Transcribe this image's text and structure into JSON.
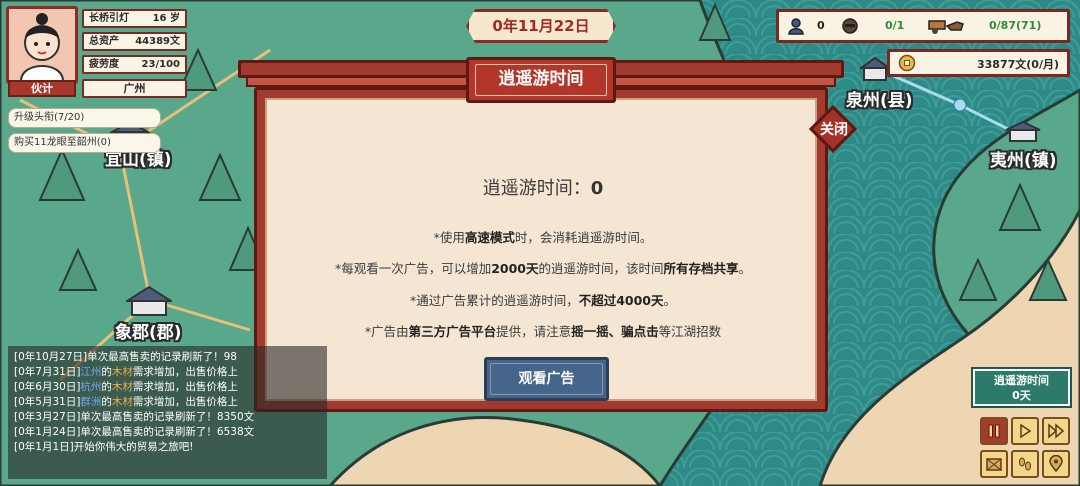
{
  "player": {
    "stats": [
      {
        "key": "长桥引灯",
        "value": "16 岁"
      },
      {
        "key": "总资产",
        "value": "44389文"
      },
      {
        "key": "疲劳度",
        "value": "23/100"
      }
    ],
    "role": "伙计",
    "city": "广州"
  },
  "tasks": [
    {
      "label": "升级头衔(7/20)"
    },
    {
      "label": "购买11龙眼至韶州(0)"
    }
  ],
  "date": "0年11月22日",
  "resources": {
    "person_count": "0",
    "bandit_count": "0/1",
    "cart_count": "0/87(71)",
    "money": "33877文(0/月)"
  },
  "map": {
    "towns": [
      {
        "name": "宜山(镇)"
      },
      {
        "name": "象郡(郡)"
      },
      {
        "name": "泉州(县)"
      },
      {
        "name": "夷州(镇)"
      }
    ],
    "colors": {
      "sea": "#2e8a86",
      "land": "#5aa88b",
      "sand": "#efd6b3",
      "road": "#e7c07a"
    }
  },
  "dialog": {
    "title": "逍遥游时间",
    "close": "关闭",
    "free_time_label": "逍遥游时间：",
    "free_time_value": "0",
    "rules": [
      {
        "pre": "*使用",
        "bold": "高速模式",
        "post": "时，会消耗逍遥游时间。",
        "bold2": "",
        "post2": ""
      },
      {
        "pre": "*每观看一次广告，可以增加",
        "bold": "2000天",
        "post": "的逍遥游时间，该时间",
        "bold2": "所有存档共享",
        "post2": "。"
      },
      {
        "pre": "*通过广告累计的逍遥游时间，",
        "bold": "不超过4000天",
        "post": "。",
        "bold2": "",
        "post2": ""
      },
      {
        "pre": "*广告由",
        "bold": "第三方广告平台",
        "post": "提供，请注意",
        "bold2": "摇一摇、骗点击",
        "post2": "等江湖招数"
      }
    ],
    "watch_ad": "观看广告"
  },
  "log": [
    {
      "date": "[0年10月27日]",
      "place": "",
      "good": "",
      "text": "单次最高售卖的记录刷新了！98"
    },
    {
      "date": "[0年7月31日]",
      "place": "江州",
      "good": "木材",
      "text": "需求增加，出售价格上"
    },
    {
      "date": "[0年6月30日]",
      "place": "杭州",
      "good": "木材",
      "text": "需求增加，出售价格上"
    },
    {
      "date": "[0年5月31日]",
      "place": "群洲",
      "good": "木材",
      "text": "需求增加，出售价格上"
    },
    {
      "date": "[0年3月27日]",
      "place": "",
      "good": "",
      "text": "单次最高售卖的记录刷新了！8350文"
    },
    {
      "date": "[0年1月24日]",
      "place": "",
      "good": "",
      "text": "单次最高售卖的记录刷新了！6538文"
    },
    {
      "date": "[0年1月1日]",
      "place": "",
      "good": "",
      "text": "开始你伟大的贸易之旅吧!"
    }
  ],
  "controls": {
    "free_time_title": "逍遥游时间",
    "free_time_days": "0天",
    "buttons": [
      {
        "icon": "pause-icon"
      },
      {
        "icon": "play-icon"
      },
      {
        "icon": "fast-forward-icon"
      },
      {
        "icon": "cargo-crate-icon"
      },
      {
        "icon": "footprints-icon"
      },
      {
        "icon": "map-pin-icon"
      }
    ]
  }
}
